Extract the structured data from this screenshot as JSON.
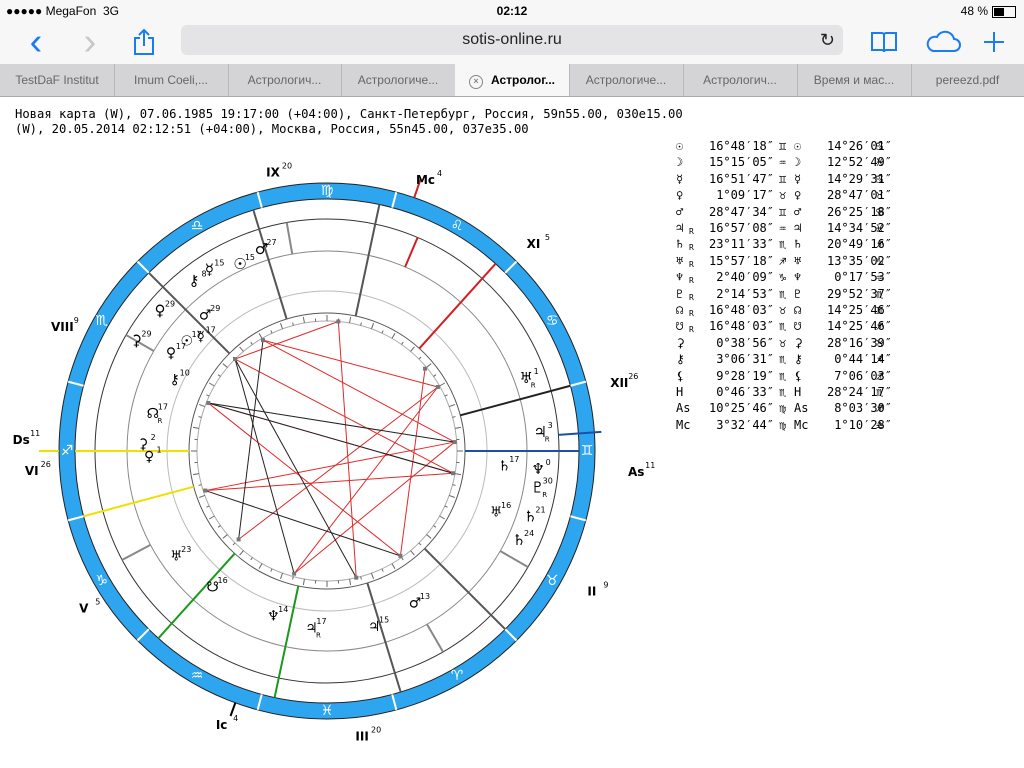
{
  "status": {
    "carrier": "MegaFon",
    "network": "3G",
    "time": "02:12",
    "battery": "48 %",
    "battery_level": 0.48
  },
  "nav": {
    "back": "‹",
    "forward": "›",
    "url": "sotis-online.ru"
  },
  "tabs": [
    {
      "label": "TestDaF Institut",
      "active": false
    },
    {
      "label": "Imum Coeli,...",
      "active": false
    },
    {
      "label": "Астрологич...",
      "active": false
    },
    {
      "label": "Астрологиче...",
      "active": false
    },
    {
      "label": "Астролог...",
      "active": true
    },
    {
      "label": "Астрологиче...",
      "active": false
    },
    {
      "label": "Астрологич...",
      "active": false
    },
    {
      "label": "Время и мас...",
      "active": false
    },
    {
      "label": "pereezd.pdf",
      "active": false
    }
  ],
  "header": {
    "line1": "Новая карта (W), 07.06.1985 19:17:00 (+04:00), Санкт-Петербург, Россия, 59n55.00, 030e15.00",
    "line2": "(W), 20.05.2014 02:12:51 (+04:00), Москва, Россия, 55n45.00, 037e35.00"
  },
  "wheel": {
    "zodiac_glyphs": [
      "♋",
      "♌",
      "♍",
      "♎",
      "♏",
      "♐",
      "♑",
      "♒",
      "♓",
      "♈",
      "♉",
      "♊"
    ],
    "house_labels": [
      {
        "text": "IX",
        "sup": "20"
      },
      {
        "text": "Mc",
        "sup": "4"
      },
      {
        "text": "XI",
        "sup": "5"
      },
      {
        "text": "XII",
        "sup": "26"
      },
      {
        "text": "As",
        "sup": "11"
      },
      {
        "text": "II",
        "sup": "9"
      },
      {
        "text": "III",
        "sup": "20"
      },
      {
        "text": "Ic",
        "sup": "4"
      },
      {
        "text": "V",
        "sup": "5"
      },
      {
        "text": "VI",
        "sup": "26"
      },
      {
        "text": "Ds",
        "sup": "11"
      },
      {
        "text": "VIII",
        "sup": "9"
      }
    ],
    "outer_planets": [
      {
        "g": "☿",
        "d": "15"
      },
      {
        "g": "♂",
        "d": "27"
      },
      {
        "g": "☉",
        "d": "15"
      },
      {
        "g": "⚷",
        "d": "8"
      },
      {
        "g": "♀",
        "d": "29"
      },
      {
        "g": "⚳",
        "d": "29"
      },
      {
        "g": "♅",
        "d": "1",
        "r": "R"
      },
      {
        "g": "♃",
        "d": "3",
        "r": "R"
      },
      {
        "g": "♆",
        "d": "0"
      },
      {
        "g": "♇",
        "d": "30",
        "r": "R"
      },
      {
        "g": "♄",
        "d": "21"
      },
      {
        "g": "♄",
        "d": "24"
      }
    ],
    "inner_planets": [
      {
        "g": "♀",
        "d": "17"
      },
      {
        "g": "☉",
        "d": "17"
      },
      {
        "g": "♂",
        "d": "29"
      },
      {
        "g": "☿",
        "d": "17"
      },
      {
        "g": "⚷",
        "d": "10"
      },
      {
        "g": "☊",
        "d": "17",
        "r": "R"
      },
      {
        "g": "⚳",
        "d": "2"
      },
      {
        "g": "♀",
        "d": "1"
      },
      {
        "g": "♅",
        "d": "16"
      },
      {
        "g": "♂",
        "d": "13"
      },
      {
        "g": "♃",
        "d": "15"
      },
      {
        "g": "♃",
        "d": "17",
        "r": "R"
      },
      {
        "g": "♆",
        "d": "14"
      },
      {
        "g": "☋",
        "d": "16"
      },
      {
        "g": "♅",
        "d": "23"
      },
      {
        "g": "♄",
        "d": "17"
      }
    ]
  },
  "table": [
    {
      "g1": "☉",
      "r1": "",
      "v1": "16°48′18″",
      "s1": "♊",
      "g2": "☉",
      "r2": "",
      "v2": "14°26′01″",
      "s2": "♋"
    },
    {
      "g1": "☽",
      "r1": "",
      "v1": "15°15′05″",
      "s1": "♒",
      "g2": "☽",
      "r2": "",
      "v2": "12°52′49″",
      "s2": "♓"
    },
    {
      "g1": "☿",
      "r1": "",
      "v1": "16°51′47″",
      "s1": "♊",
      "g2": "☿",
      "r2": "",
      "v2": "14°29′31″",
      "s2": "♋"
    },
    {
      "g1": "♀",
      "r1": "",
      "v1": "1°09′17″",
      "s1": "♉",
      "g2": "♀",
      "r2": "",
      "v2": "28°47′01″",
      "s2": "♉"
    },
    {
      "g1": "♂",
      "r1": "",
      "v1": "28°47′34″",
      "s1": "♊",
      "g2": "♂",
      "r2": "",
      "v2": "26°25′18″",
      "s2": "♋"
    },
    {
      "g1": "♃",
      "r1": "R",
      "v1": "16°57′08″",
      "s1": "♒",
      "g2": "♃",
      "r2": "",
      "v2": "14°34′52″",
      "s2": "♓"
    },
    {
      "g1": "♄",
      "r1": "R",
      "v1": "23°11′33″",
      "s1": "♏",
      "g2": "♄",
      "r2": "",
      "v2": "20°49′16″",
      "s2": "♐"
    },
    {
      "g1": "♅",
      "r1": "R",
      "v1": "15°57′18″",
      "s1": "♐",
      "g2": "♅",
      "r2": "",
      "v2": "13°35′02″",
      "s2": "♑"
    },
    {
      "g1": "♆",
      "r1": "R",
      "v1": "2°40′09″",
      "s1": "♑",
      "g2": "♆",
      "r2": "",
      "v2": "0°17′53″",
      "s2": "♒"
    },
    {
      "g1": "♇",
      "r1": "R",
      "v1": "2°14′53″",
      "s1": "♏",
      "g2": "♇",
      "r2": "",
      "v2": "29°52′37″",
      "s2": "♏"
    },
    {
      "g1": "☊",
      "r1": "R",
      "v1": "16°48′03″",
      "s1": "♉",
      "g2": "☊",
      "r2": "",
      "v2": "14°25′46″",
      "s2": "♊"
    },
    {
      "g1": "☋",
      "r1": "R",
      "v1": "16°48′03″",
      "s1": "♏",
      "g2": "☋",
      "r2": "",
      "v2": "14°25′46″",
      "s2": "♐"
    },
    {
      "g1": "⚳",
      "r1": "",
      "v1": "0°38′56″",
      "s1": "♉",
      "g2": "⚳",
      "r2": "",
      "v2": "28°16′39″",
      "s2": "♉"
    },
    {
      "g1": "⚷",
      "r1": "",
      "v1": "3°06′31″",
      "s1": "♏",
      "g2": "⚷",
      "r2": "",
      "v2": "0°44′14″",
      "s2": "♐"
    },
    {
      "g1": "⚸",
      "r1": "",
      "v1": "9°28′19″",
      "s1": "♏",
      "g2": "⚸",
      "r2": "",
      "v2": "7°06′03″",
      "s2": "♐"
    },
    {
      "g1": "H",
      "r1": "",
      "v1": "0°46′33″",
      "s1": "♏",
      "g2": "H",
      "r2": "",
      "v2": "28°24′17″",
      "s2": "♏"
    },
    {
      "g1": "As",
      "r1": "",
      "v1": "10°25′46″",
      "s1": "♍",
      "g2": "As",
      "r2": "",
      "v2": "8°03′30″",
      "s2": "♐"
    },
    {
      "g1": "Mc",
      "r1": "",
      "v1": "3°32′44″",
      "s1": "♍",
      "g2": "Mc",
      "r2": "",
      "v2": "1°10′28″",
      "s2": "♎"
    }
  ],
  "colors": {
    "zodiac_band": "#2ea6ef",
    "accent": "#1a7cf5",
    "aspect_red": "#e02a2a",
    "aspect_black": "#222222",
    "cusp_red": "#d31f1f",
    "cusp_green": "#1a9a1a",
    "cusp_yellow": "#f0e000",
    "cusp_blue": "#1b4fa8"
  }
}
